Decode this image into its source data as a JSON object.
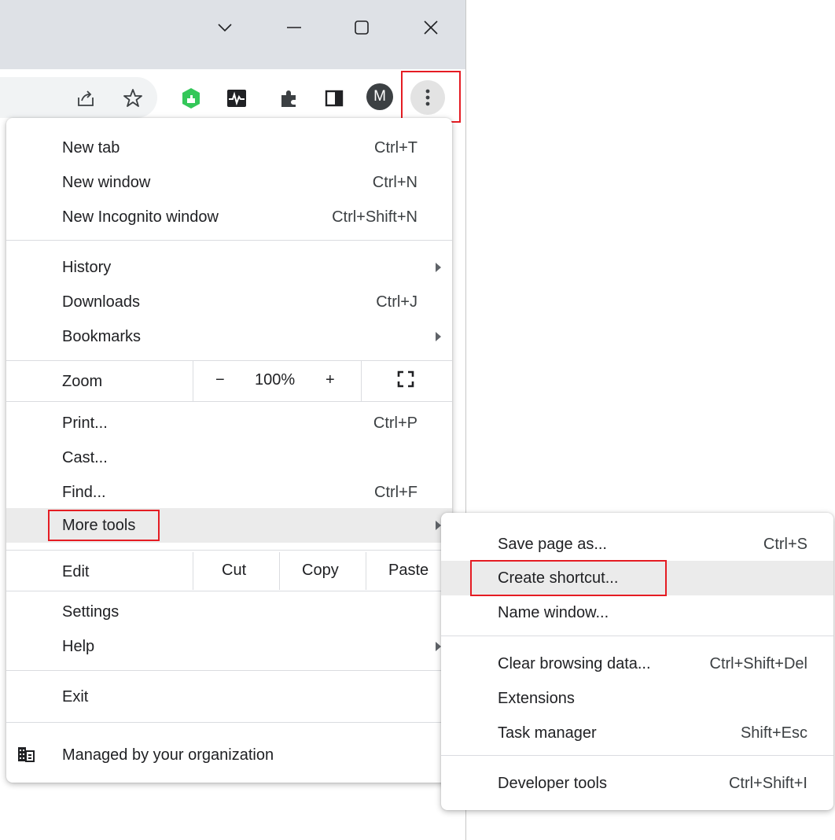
{
  "window_controls": {
    "tab_search": "chevron-down",
    "minimize": "minimize",
    "maximize": "maximize",
    "close": "close"
  },
  "toolbar": {
    "icons": [
      "share-icon",
      "star-icon",
      "green-extension-icon",
      "monitor-extension-icon",
      "puzzle-icon",
      "side-panel-icon"
    ],
    "profile_initial": "M",
    "menu_icon": "kebab-icon"
  },
  "menu": {
    "new_tab": {
      "label": "New tab",
      "shortcut": "Ctrl+T"
    },
    "new_window": {
      "label": "New window",
      "shortcut": "Ctrl+N"
    },
    "new_incognito": {
      "label": "New Incognito window",
      "shortcut": "Ctrl+Shift+N"
    },
    "history": {
      "label": "History"
    },
    "downloads": {
      "label": "Downloads",
      "shortcut": "Ctrl+J"
    },
    "bookmarks": {
      "label": "Bookmarks"
    },
    "zoom": {
      "label": "Zoom",
      "minus": "−",
      "value": "100%",
      "plus": "+"
    },
    "print": {
      "label": "Print...",
      "shortcut": "Ctrl+P"
    },
    "cast": {
      "label": "Cast..."
    },
    "find": {
      "label": "Find...",
      "shortcut": "Ctrl+F"
    },
    "more_tools": {
      "label": "More tools"
    },
    "edit": {
      "label": "Edit",
      "cut": "Cut",
      "copy": "Copy",
      "paste": "Paste"
    },
    "settings": {
      "label": "Settings"
    },
    "help": {
      "label": "Help"
    },
    "exit": {
      "label": "Exit"
    },
    "managed": {
      "label": "Managed by your organization"
    }
  },
  "submenu": {
    "save_page": {
      "label": "Save page as...",
      "shortcut": "Ctrl+S"
    },
    "create_shortcut": {
      "label": "Create shortcut..."
    },
    "name_window": {
      "label": "Name window..."
    },
    "clear_data": {
      "label": "Clear browsing data...",
      "shortcut": "Ctrl+Shift+Del"
    },
    "extensions": {
      "label": "Extensions"
    },
    "task_manager": {
      "label": "Task manager",
      "shortcut": "Shift+Esc"
    },
    "dev_tools": {
      "label": "Developer tools",
      "shortcut": "Ctrl+Shift+I"
    }
  },
  "colors": {
    "highlight_box": "#e51c23",
    "hover_row": "#ebebeb",
    "titlebar": "#dee1e6"
  }
}
